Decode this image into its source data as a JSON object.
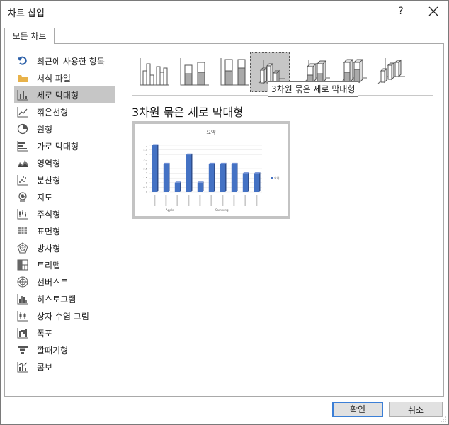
{
  "dialog": {
    "title": "차트 삽입",
    "help": "?",
    "tab": "모든 차트"
  },
  "sidebar": {
    "items": [
      {
        "label": "최근에 사용한 항목",
        "icon": "undo-arrow-icon"
      },
      {
        "label": "서식 파일",
        "icon": "folder-icon"
      },
      {
        "label": "세로 막대형",
        "icon": "column-chart-icon"
      },
      {
        "label": "꺾은선형",
        "icon": "line-chart-icon"
      },
      {
        "label": "원형",
        "icon": "pie-chart-icon"
      },
      {
        "label": "가로 막대형",
        "icon": "bar-chart-icon"
      },
      {
        "label": "영역형",
        "icon": "area-chart-icon"
      },
      {
        "label": "분산형",
        "icon": "scatter-chart-icon"
      },
      {
        "label": "지도",
        "icon": "map-chart-icon"
      },
      {
        "label": "주식형",
        "icon": "stock-chart-icon"
      },
      {
        "label": "표면형",
        "icon": "surface-chart-icon"
      },
      {
        "label": "방사형",
        "icon": "radar-chart-icon"
      },
      {
        "label": "트리맵",
        "icon": "treemap-chart-icon"
      },
      {
        "label": "선버스트",
        "icon": "sunburst-chart-icon"
      },
      {
        "label": "히스토그램",
        "icon": "histogram-chart-icon"
      },
      {
        "label": "상자 수염 그림",
        "icon": "box-whisker-chart-icon"
      },
      {
        "label": "폭포",
        "icon": "waterfall-chart-icon"
      },
      {
        "label": "깔때기형",
        "icon": "funnel-chart-icon"
      },
      {
        "label": "콤보",
        "icon": "combo-chart-icon"
      }
    ],
    "selected_index": 2
  },
  "subtypes": {
    "selected_index": 3,
    "tooltip": "3차원 묶은 세로 막대형"
  },
  "main": {
    "section_title": "3차원 묶은 세로 막대형"
  },
  "preview": {
    "title": "요약",
    "legend": "요약",
    "groups": [
      "Apple",
      "Samsung"
    ],
    "yticks": [
      "5",
      "4.5",
      "4",
      "3.5",
      "3",
      "2.5",
      "2",
      "1.5",
      "1",
      "0.5",
      "0"
    ],
    "values": [
      5,
      3,
      1,
      4,
      1,
      3,
      3,
      3,
      2,
      2
    ]
  },
  "buttons": {
    "ok": "확인",
    "cancel": "취소"
  },
  "colors": {
    "accent_blue": "#3c7fd6",
    "bar_blue": "#4472c4",
    "icon_gray": "#555555",
    "selection_gray": "#c6c6c6"
  }
}
